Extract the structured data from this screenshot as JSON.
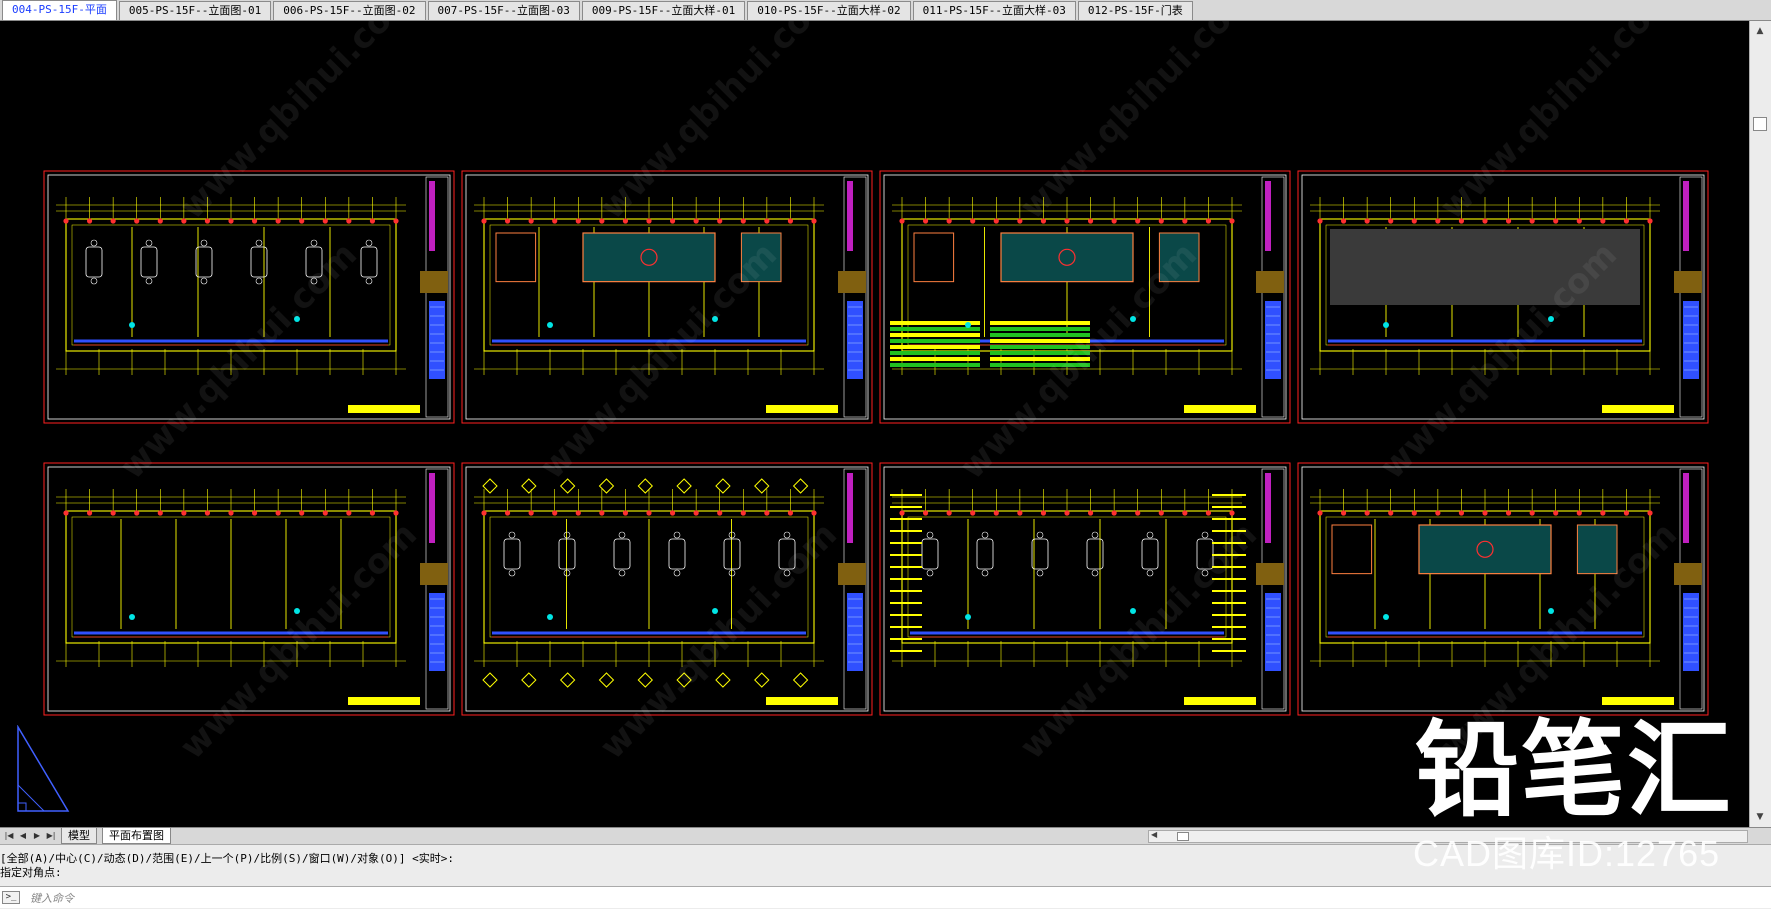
{
  "drawing_tabs": [
    {
      "label": "004-PS-15F-平面",
      "active": true
    },
    {
      "label": "005-PS-15F--立面图-01",
      "active": false
    },
    {
      "label": "006-PS-15F--立面图-02",
      "active": false
    },
    {
      "label": "007-PS-15F--立面图-03",
      "active": false
    },
    {
      "label": "009-PS-15F--立面大样-01",
      "active": false
    },
    {
      "label": "010-PS-15F--立面大样-02",
      "active": false
    },
    {
      "label": "011-PS-15F--立面大样-03",
      "active": false
    },
    {
      "label": "012-PS-15F-门表",
      "active": false
    }
  ],
  "layout_tabs": {
    "model": "模型",
    "layout": "平面布置图"
  },
  "command": {
    "line1": "[全部(A)/中心(C)/动态(D)/范围(E)/上一个(P)/比例(S)/窗口(W)/对象(O)] <实时>:",
    "line2": "指定对角点:",
    "placeholder": "键入命令",
    "prompt_icon": ">_"
  },
  "watermark": {
    "text": "www.qbihui.com",
    "brand_name": "铅笔汇",
    "brand_id": "CAD图库ID:12765"
  },
  "icons": {
    "nav_first": "nav-first-icon",
    "nav_prev": "nav-prev-icon",
    "nav_next": "nav-next-icon",
    "nav_last": "nav-last-icon",
    "scroll_up": "scroll-up-icon",
    "scroll_down": "scroll-down-icon",
    "ucs": "ucs-icon"
  },
  "colors": {
    "background": "#000000",
    "sheet_border": "#ff2020",
    "linework": "#ffff00",
    "accent_cyan": "#00e5e5",
    "accent_blue": "#3050ff",
    "accent_magenta": "#c020c0",
    "active_tab_text": "#1a3cff"
  }
}
